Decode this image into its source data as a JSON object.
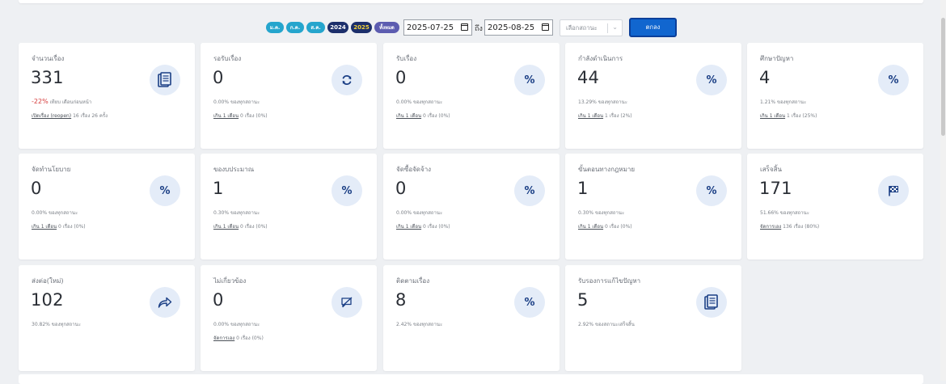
{
  "filters": {
    "pills": [
      {
        "label": "ม.ค.",
        "color": "#25a5cd"
      },
      {
        "label": "ก.ค.",
        "color": "#25a5cd"
      },
      {
        "label": "ส.ค.",
        "color": "#25a5cd"
      },
      {
        "label": "2024",
        "color": "#1c2f6b"
      },
      {
        "label": "2025",
        "color": "#1c2f6b"
      },
      {
        "label": "ทั้งหมด",
        "color": "#5c5cb0"
      }
    ],
    "date_from": "2025-07-25",
    "to_label": "ถึง",
    "date_to": "2025-08-25",
    "status_select": "เลือกสถานะ",
    "ok_label": "ตกลง"
  },
  "colors": {
    "accent": "#1166cf",
    "icon_bg": "#e4ecf8",
    "icon_fg": "#1b3f85",
    "negative": "#d53a3a"
  },
  "cards": [
    {
      "title": "จำนวนเรื่อง",
      "value": "331",
      "icon": "documents-icon",
      "pct": "-22%",
      "line1_suffix": " เทียบ เดือนก่อนหน้า",
      "link": "เปิดเรื่อง (reopen)",
      "line2_suffix": " 16 เรื่อง 26 ครั้ง"
    },
    {
      "title": "รอรับเรื่อง",
      "value": "0",
      "icon": "refresh-icon",
      "line1": "0.00% ของทุกสถานะ",
      "link": "เกิน 1 เดือน",
      "line2_suffix": " 0 เรื่อง (0%)"
    },
    {
      "title": "รับเรื่อง",
      "value": "0",
      "icon": "percent-icon",
      "line1": "0.00% ของทุกสถานะ",
      "link": "เกิน 1 เดือน",
      "line2_suffix": " 0 เรื่อง (0%)"
    },
    {
      "title": "กำลังดำเนินการ",
      "value": "44",
      "icon": "percent-icon",
      "line1": "13.29% ของทุกสถานะ",
      "link": "เกิน 1 เดือน",
      "line2_suffix": " 1 เรื่อง (2%)"
    },
    {
      "title": "ศึกษาปัญหา",
      "value": "4",
      "icon": "percent-icon",
      "line1": "1.21% ของทุกสถานะ",
      "link": "เกิน 1 เดือน",
      "line2_suffix": " 1 เรื่อง (25%)"
    },
    {
      "title": "จัดทำนโยบาย",
      "value": "0",
      "icon": "percent-icon",
      "line1": "0.00% ของทุกสถานะ",
      "link": "เกิน 1 เดือน",
      "line2_suffix": " 0 เรื่อง (0%)"
    },
    {
      "title": "ของบประมาณ",
      "value": "1",
      "icon": "percent-icon",
      "line1": "0.30% ของทุกสถานะ",
      "link": "เกิน 1 เดือน",
      "line2_suffix": " 0 เรื่อง (0%)"
    },
    {
      "title": "จัดซื้อจัดจ้าง",
      "value": "0",
      "icon": "percent-icon",
      "line1": "0.00% ของทุกสถานะ",
      "link": "เกิน 1 เดือน",
      "line2_suffix": " 0 เรื่อง (0%)"
    },
    {
      "title": "ขั้นตอนทางกฎหมาย",
      "value": "1",
      "icon": "percent-icon",
      "line1": "0.30% ของทุกสถานะ",
      "link": "เกิน 1 เดือน",
      "line2_suffix": " 0 เรื่อง (0%)"
    },
    {
      "title": "เสร็จสิ้น",
      "value": "171",
      "icon": "checkered-flag-icon",
      "line1": "51.66% ของทุกสถานะ",
      "link": "จัดการเอง",
      "line2_suffix": " 136 เรื่อง (80%)"
    },
    {
      "title": "ส่งต่อ(ใหม่)",
      "value": "102",
      "icon": "share-arrow-icon",
      "line1": "30.82% ของทุกสถานะ"
    },
    {
      "title": "ไม่เกี่ยวข้อง",
      "value": "0",
      "icon": "comment-slash-icon",
      "line1": "0.00% ของทุกสถานะ",
      "link": "จัดการเอง",
      "line2_suffix": " 0 เรื่อง (0%)"
    },
    {
      "title": "ติดตามเรื่อง",
      "value": "8",
      "icon": "percent-icon",
      "line1": "2.42% ของทุกสถานะ"
    },
    {
      "title": "รับรองการแก้ไขปัญหา",
      "value": "5",
      "icon": "documents-icon",
      "line1": "2.92% ของสถานะเสร็จสิ้น"
    }
  ]
}
